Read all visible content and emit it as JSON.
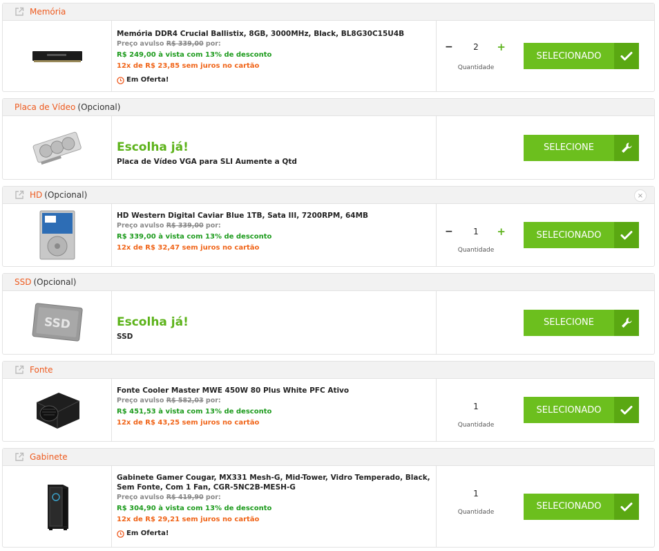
{
  "labels": {
    "selected": "SELECIONADO",
    "select": "SELECIONE",
    "qty": "Quantidade",
    "offer": "Em Oferta!",
    "choose": "Escolha já!",
    "optional": "(Opcional)",
    "minus": "−",
    "plus": "+"
  },
  "colors": {
    "accent_green": "#6cbf1e",
    "dark_green": "#5aa812",
    "orange": "#ee5a1e",
    "price_green": "#1d9b1d"
  },
  "items": [
    {
      "category": "Memória",
      "title": "Memória DDR4 Crucial Ballistix, 8GB, 3000MHz, Black, BL8G30C15U4B",
      "avulso_prefix": "Preço avulso",
      "avulso_price": "R$ 339,00",
      "avulso_suffix": "por:",
      "vista": "R$ 249,00 à vista com 13% de desconto",
      "parcelado": "12x de R$ 23,85 sem juros no cartão",
      "qty": "2",
      "icon": "ram-image"
    },
    {
      "category": "Placa de Vídeo",
      "subtitle": "Placa de Vídeo VGA para SLI Aumente a Qtd",
      "icon": "gpu-image"
    },
    {
      "category": "HD",
      "title": "HD Western Digital Caviar Blue 1TB, Sata III, 7200RPM, 64MB",
      "avulso_prefix": "Preço avulso",
      "avulso_price": "R$ 339,00",
      "avulso_suffix": "por:",
      "vista": "R$ 339,00 à vista com 13% de desconto",
      "parcelado": "12x de R$ 32,47 sem juros no cartão",
      "qty": "1",
      "close": "×",
      "icon": "hd-image"
    },
    {
      "category": "SSD",
      "subtitle": "SSD",
      "image_text": "SSD",
      "icon": "ssd-image"
    },
    {
      "category": "Fonte",
      "title": "Fonte Cooler Master MWE 450W 80 Plus White PFC Ativo",
      "avulso_prefix": "Preço avulso",
      "avulso_price": "R$ 582,03",
      "avulso_suffix": "por:",
      "vista": "R$ 451,53 à vista com 13% de desconto",
      "parcelado": "12x de R$ 43,25 sem juros no cartão",
      "qty": "1",
      "icon": "psu-image"
    },
    {
      "category": "Gabinete",
      "title": "Gabinete Gamer Cougar, MX331 Mesh-G, Mid-Tower, Vidro Temperado, Black, Sem Fonte, Com 1 Fan, CGR-5NC2B-MESH-G",
      "avulso_prefix": "Preço avulso",
      "avulso_price": "R$ 419,90",
      "avulso_suffix": "por:",
      "vista": "R$ 304,90 à vista com 13% de desconto",
      "parcelado": "12x de R$ 29,21 sem juros no cartão",
      "qty": "1",
      "icon": "case-image"
    }
  ]
}
